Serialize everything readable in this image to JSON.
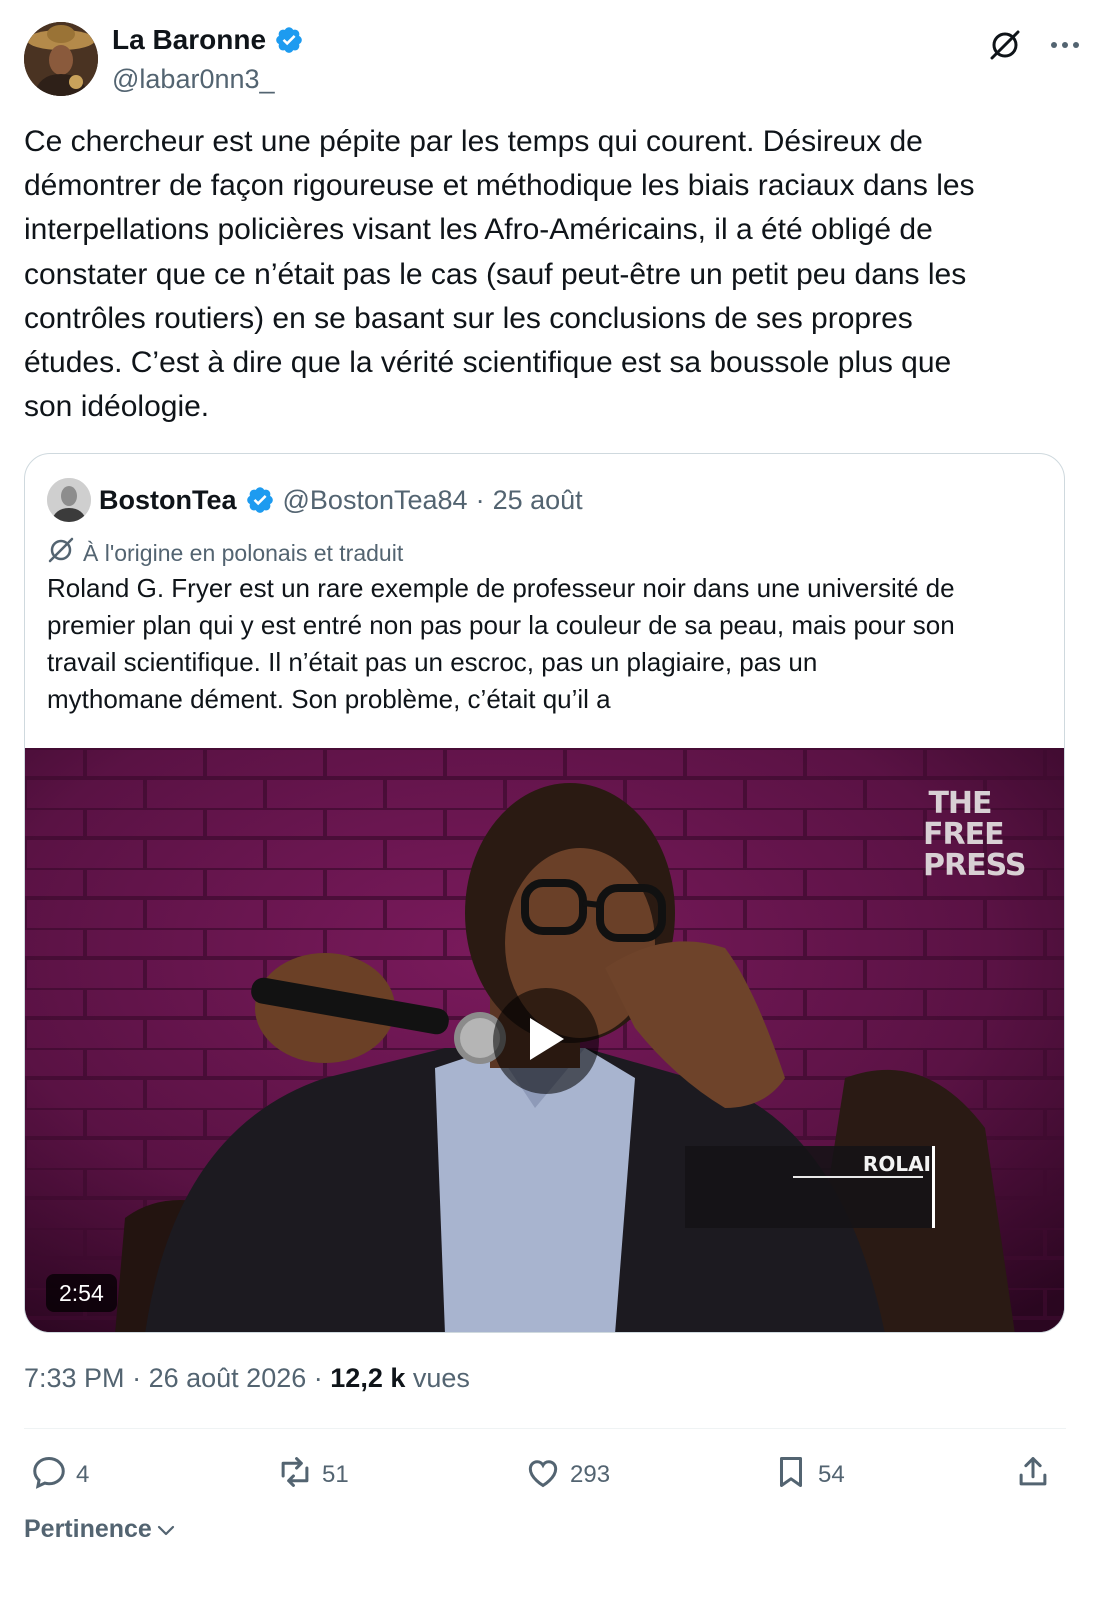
{
  "author": {
    "display_name": "La Baronne",
    "handle": "@labar0nn3_",
    "verified": true
  },
  "tweet": {
    "text": "Ce chercheur est une pépite par les temps qui courent. Désireux de\ndémontrer de façon rigoureuse et méthodique les biais raciaux dans les\ninterpellations policières visant les Afro-Américains, il a été obligé de\nconstater que ce n’était pas le cas (sauf peut-être un petit peu dans les\ncontrôles routiers) en se basant sur les conclusions de ses propres\nétudes. C’est à dire que la vérité scientifique est sa boussole plus que\nson idéologie."
  },
  "quote": {
    "display_name": "BostonTea",
    "handle": "@BostonTea84",
    "separator": "·",
    "date": "25 août",
    "translation_note": "À l'origine en polonais et traduit",
    "text": "Roland G. Fryer est un rare exemple de professeur noir dans une université de\npremier plan qui y est entré non pas pour la couleur de sa peau, mais pour son\ntravail scientifique. Il n’était pas un escroc, pas un plagiaire, pas un\nmythomane dément. Son problème, c’était qu’il a",
    "video": {
      "duration": "2:54",
      "watermark_line1": "THE",
      "watermark_line2": "FREE",
      "watermark_line3": "PRESS",
      "lower_third": "ROLAI"
    }
  },
  "meta": {
    "time": "7:33 PM",
    "separator": "·",
    "date": "26 août 2026",
    "views_count": "12,2 k",
    "views_label": "vues"
  },
  "actions": {
    "replies": "4",
    "reposts": "51",
    "likes": "293",
    "bookmarks": "54"
  },
  "sort": {
    "label": "Pertinence"
  },
  "colors": {
    "verified": "#1d9bf0",
    "text": "#0f1419",
    "secondary": "#536471",
    "border": "#cfd9de"
  }
}
